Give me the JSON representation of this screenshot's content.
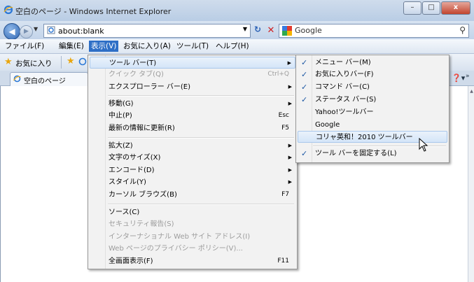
{
  "window": {
    "title": "空白のページ - Windows Internet Explorer",
    "buttons": {
      "minimize": "–",
      "maximize": "□",
      "close": "x"
    }
  },
  "address": {
    "value": "about:blank",
    "refresh_icon": "refresh-icon",
    "stop_icon": "stop-icon"
  },
  "search": {
    "value": "Google"
  },
  "menubar": [
    {
      "label": "ファイル(F)"
    },
    {
      "label": "編集(E)"
    },
    {
      "label": "表示(V)"
    },
    {
      "label": "お気に入り(A)"
    },
    {
      "label": "ツール(T)"
    },
    {
      "label": "ヘルプ(H)"
    }
  ],
  "favorites": {
    "label": "お気に入り"
  },
  "tab": {
    "label": "空白のページ"
  },
  "view_menu": {
    "items": [
      {
        "label": "ツール バー(T)",
        "shortcut": "",
        "submenu": true,
        "disabled": false,
        "highlight": true
      },
      {
        "label": "クイック タブ(Q)",
        "shortcut": "Ctrl+Q",
        "submenu": false,
        "disabled": true
      },
      {
        "label": "エクスプローラー バー(E)",
        "shortcut": "",
        "submenu": true,
        "disabled": false
      },
      {
        "label": "移動(G)",
        "shortcut": "",
        "submenu": true,
        "disabled": false
      },
      {
        "label": "中止(P)",
        "shortcut": "Esc",
        "submenu": false,
        "disabled": false
      },
      {
        "label": "最新の情報に更新(R)",
        "shortcut": "F5",
        "submenu": false,
        "disabled": false
      },
      {
        "label": "拡大(Z)",
        "shortcut": "",
        "submenu": true,
        "disabled": false
      },
      {
        "label": "文字のサイズ(X)",
        "shortcut": "",
        "submenu": true,
        "disabled": false
      },
      {
        "label": "エンコード(D)",
        "shortcut": "",
        "submenu": true,
        "disabled": false
      },
      {
        "label": "スタイル(Y)",
        "shortcut": "",
        "submenu": true,
        "disabled": false
      },
      {
        "label": "カーソル ブラウズ(B)",
        "shortcut": "F7",
        "submenu": false,
        "disabled": false
      },
      {
        "label": "ソース(C)",
        "shortcut": "",
        "submenu": false,
        "disabled": false
      },
      {
        "label": "セキュリティ報告(S)",
        "shortcut": "",
        "submenu": false,
        "disabled": true
      },
      {
        "label": "インターナショナル Web サイト アドレス(I)",
        "shortcut": "",
        "submenu": false,
        "disabled": true
      },
      {
        "label": "Web ページのプライバシー ポリシー(V)...",
        "shortcut": "",
        "submenu": false,
        "disabled": true
      },
      {
        "label": "全画面表示(F)",
        "shortcut": "F11",
        "submenu": false,
        "disabled": false
      }
    ]
  },
  "toolbar_submenu": {
    "items": [
      {
        "label": "メニュー バー(M)",
        "checked": true
      },
      {
        "label": "お気に入りバー(F)",
        "checked": true
      },
      {
        "label": "コマンド バー(C)",
        "checked": true
      },
      {
        "label": "ステータス バー(S)",
        "checked": true
      },
      {
        "label": "Yahoo!ツールバー",
        "checked": false
      },
      {
        "label": "Google",
        "checked": false
      },
      {
        "label": "コリャ英和！2010 ツールバー",
        "checked": false,
        "highlight": true
      },
      {
        "label": "ツール バーを固定する(L)",
        "checked": true
      }
    ]
  },
  "colors": {
    "menu_highlight": "#2e6fc6",
    "check": "#1c57a4"
  }
}
